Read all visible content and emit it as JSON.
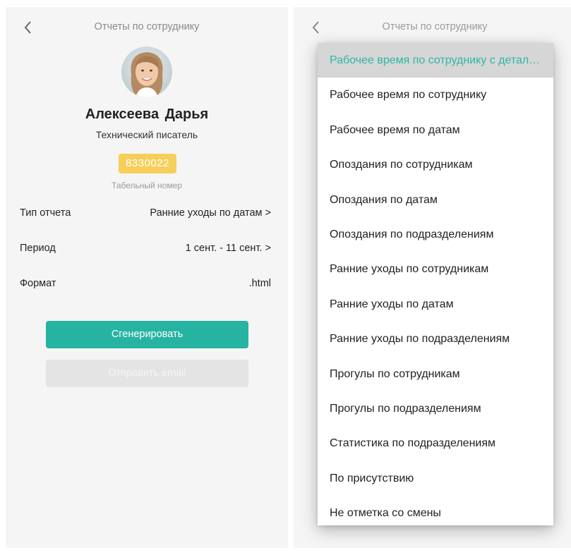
{
  "left": {
    "header": {
      "title": "Отчеты по сотруднику"
    },
    "employee": {
      "name": "Алексеева Дарья",
      "position": "Технический писатель",
      "badge_number": "8330022",
      "badge_caption": "Табельный номер"
    },
    "fields": [
      {
        "label": "Тип отчета",
        "value": "Ранние уходы по датам >"
      },
      {
        "label": "Период",
        "value": "1 сент. - 11 сент. >"
      },
      {
        "label": "Формат",
        "value": ".html"
      }
    ],
    "buttons": {
      "generate": "Сгенерировать",
      "send_email": "Отправить email"
    }
  },
  "right": {
    "header": {
      "title": "Отчеты по сотруднику"
    },
    "dropdown": {
      "selected_index": 0,
      "items": [
        "Рабочее время по сотруднику с детализацией",
        "Рабочее время по сотруднику",
        "Рабочее время по датам",
        "Опоздания по сотрудникам",
        "Опоздания по датам",
        "Опоздания по подразделениям",
        "Ранние уходы по сотрудникам",
        "Ранние уходы по датам",
        "Ранние уходы по подразделениям",
        "Прогулы по сотрудникам",
        "Прогулы по подразделениям",
        "Статистика по подразделениям",
        "По присутствию",
        "Не отметка со смены"
      ]
    }
  },
  "colors": {
    "accent": "#27b3a2",
    "badge": "#f6cf5a",
    "selected_text": "#2cb7a6",
    "selected_bg": "#d6d6d6"
  },
  "icons": [
    "chevron-left-icon",
    "avatar-photo"
  ]
}
